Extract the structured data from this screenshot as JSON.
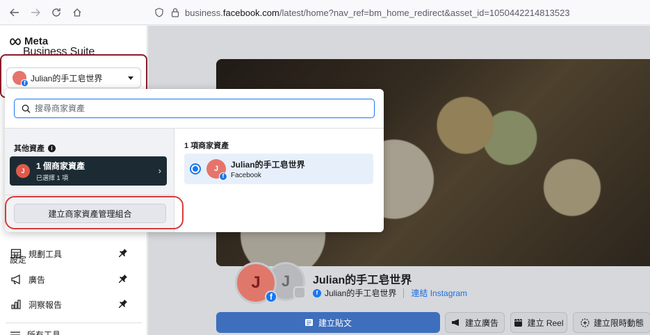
{
  "browser": {
    "url_prefix": "business.",
    "url_host": "facebook.com",
    "url_path": "/latest/home?nav_ref=bm_home_redirect&asset_id=1050442214813523",
    "icons": [
      "back-arrow-icon",
      "forward-arrow-icon",
      "reload-icon",
      "home-icon",
      "shield-icon",
      "lock-icon"
    ]
  },
  "logo": {
    "line1": "Meta",
    "line2": "Business Suite"
  },
  "account_switcher": {
    "name": "Julian的手工皂世界"
  },
  "sidebar": {
    "partial_top": "設定",
    "items": [
      {
        "label": "規劃工具",
        "icon": "calendar-grid-icon"
      },
      {
        "label": "廣告",
        "icon": "megaphone-icon"
      },
      {
        "label": "洞察報告",
        "icon": "bar-chart-icon"
      }
    ],
    "partial_bottom": "所有工具"
  },
  "dropdown": {
    "search_placeholder": "搜尋商家資產",
    "left_heading": "其他資產",
    "asset_card": {
      "avatar_letter": "J",
      "title": "1 個商家資產",
      "subtitle": "已選擇 1 項"
    },
    "create_button": "建立商家資產管理組合",
    "right_heading": "1 項商家資產",
    "result": {
      "avatar_letter": "J",
      "name": "Julian的手工皂世界",
      "platform": "Facebook"
    }
  },
  "page": {
    "avatar_letter": "J",
    "ig_letter": "J",
    "name": "Julian的手工皂世界",
    "fb_name": "Julian的手工皂世界",
    "ig_link": "連結 Instagram"
  },
  "actions": {
    "create_post": "建立貼文",
    "create_ad": "建立廣告",
    "create_reel": "建立 Reel",
    "create_story": "建立限時動態"
  },
  "colors": {
    "accent": "#1877f2",
    "highlight_box": "#8a1c2a",
    "annotation_red": "#d93a3a"
  }
}
